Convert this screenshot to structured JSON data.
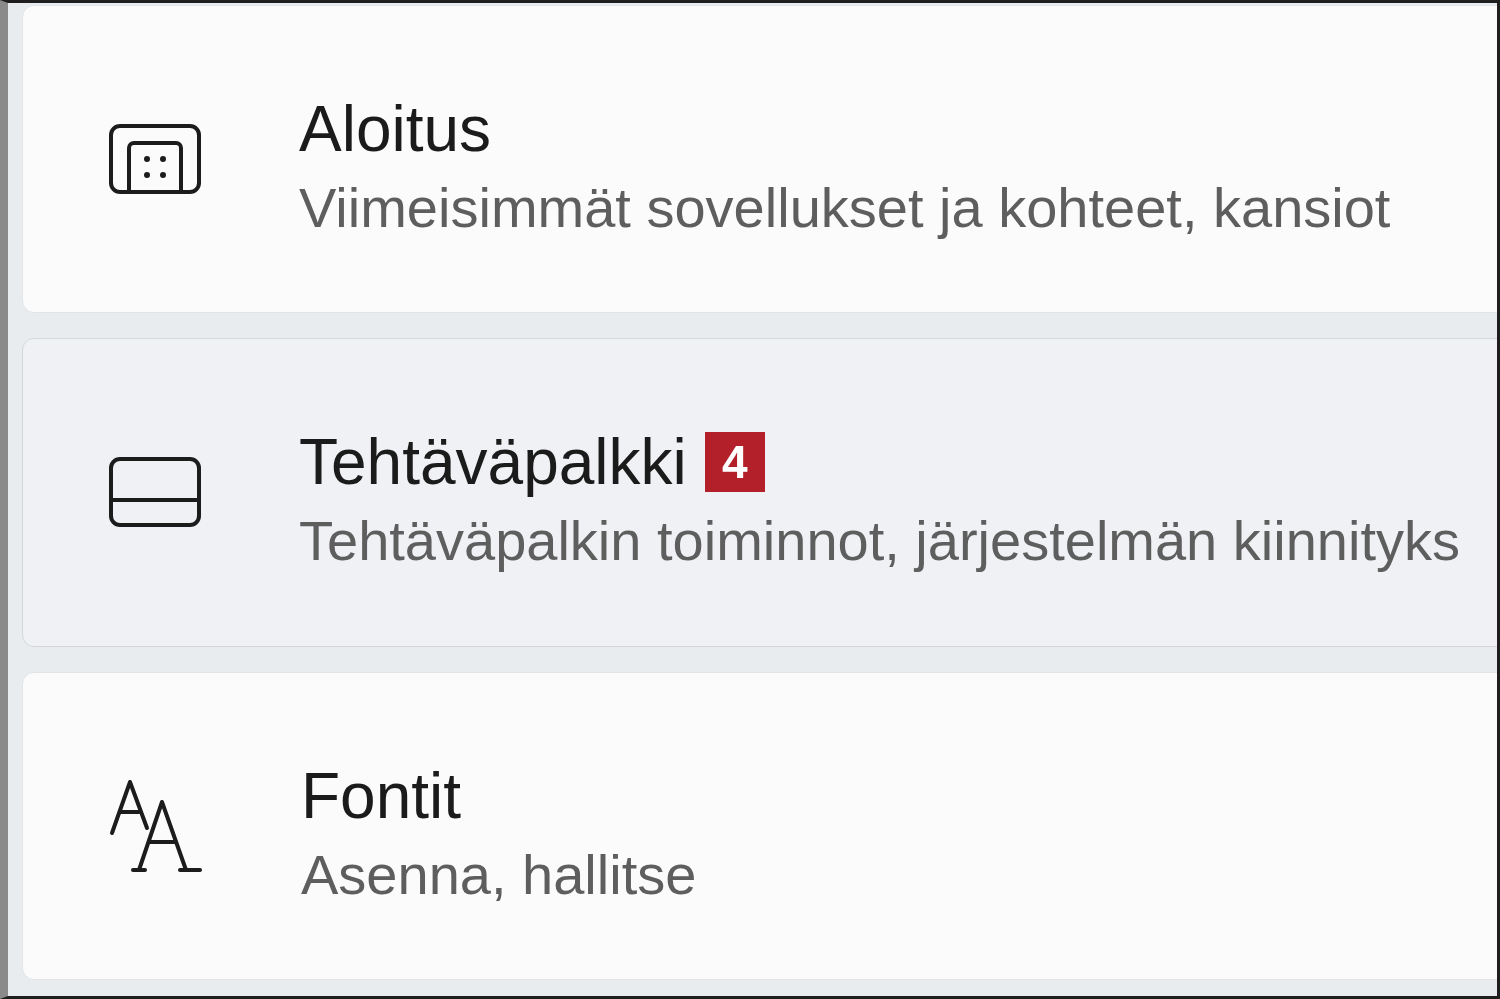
{
  "items": [
    {
      "kind": "start",
      "title": "Aloitus",
      "description": "Viimeisimmät sovellukset ja kohteet, kansiot",
      "highlighted": false
    },
    {
      "kind": "taskbar",
      "title": "Tehtäväpalkki",
      "badge": "4",
      "description": "Tehtäväpalkin toiminnot, järjestelmän kiinnityks",
      "highlighted": true
    },
    {
      "kind": "fonts",
      "title": "Fontit",
      "description": "Asenna, hallitse",
      "highlighted": false
    }
  ]
}
